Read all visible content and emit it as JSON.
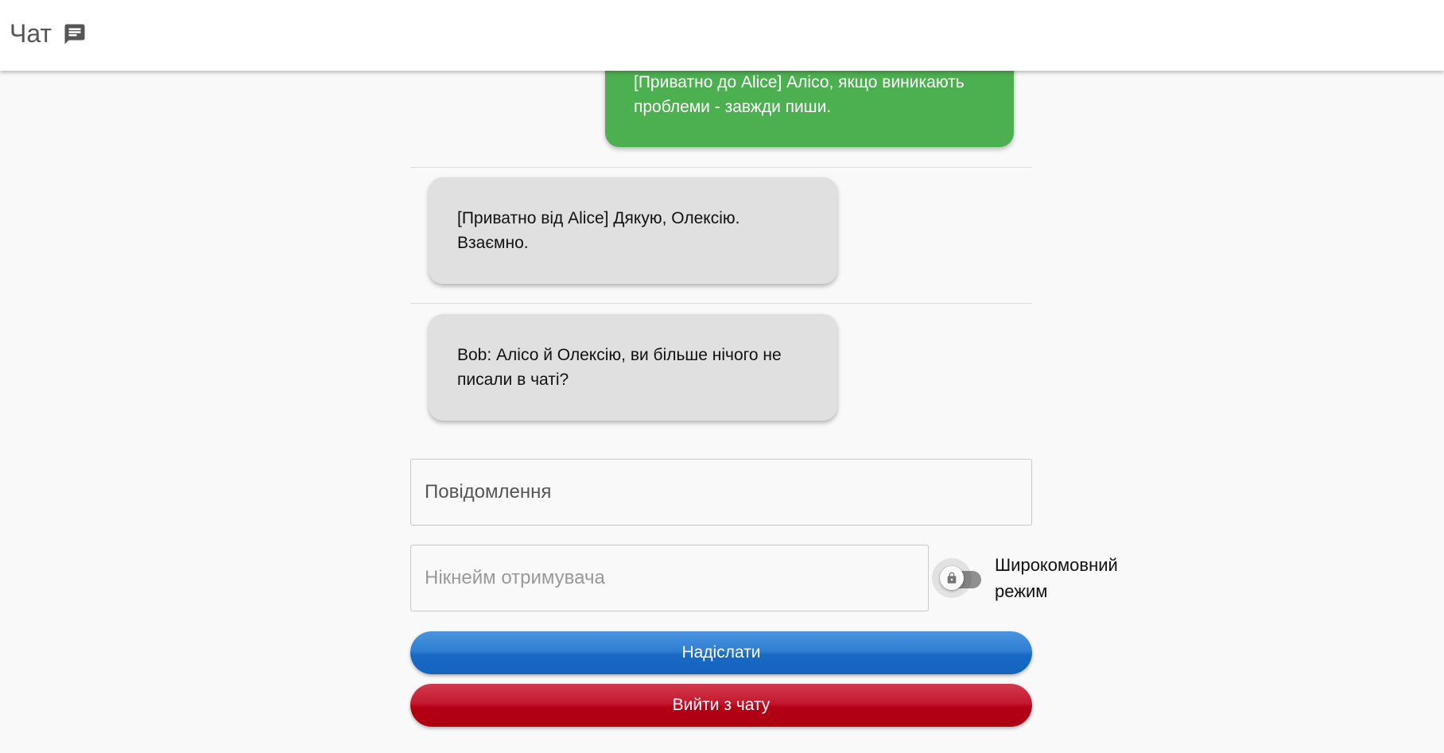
{
  "header": {
    "title": "Чат",
    "icon": "chat-icon"
  },
  "messages": [
    {
      "direction": "outgoing",
      "text": "[Приватно до Alice] Алісо, якщо виникають проблеми - завжди пиши."
    },
    {
      "direction": "incoming",
      "text": "[Приватно від Alice] Дякую, Олексію. Взаємно."
    },
    {
      "direction": "incoming",
      "text": "Bob: Алісо й Олексію, ви більше нічого не писали в чаті?"
    }
  ],
  "form": {
    "message_placeholder": "Повідомлення",
    "recipient_placeholder": "Нікнейм отримувача",
    "broadcast_label": "Широкомовний режим",
    "broadcast_enabled": false,
    "toggle_icon": "lock-icon",
    "send_label": "Надіслати",
    "leave_label": "Вийти з чату"
  },
  "colors": {
    "outgoing_bubble": "#4caf50",
    "incoming_bubble": "#e0e0e0",
    "send_button": "#1565c0",
    "leave_button": "#b00016"
  }
}
